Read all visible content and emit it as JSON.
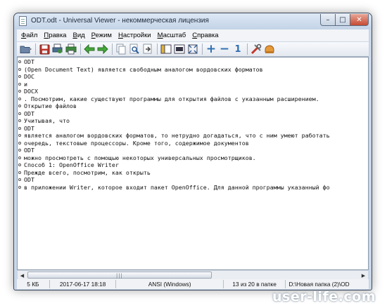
{
  "window": {
    "title": "ODT.odt - Universal Viewer - некоммерческая лицензия"
  },
  "window_controls": {
    "minimize": "–",
    "maximize": "□",
    "close": "✕"
  },
  "menu": {
    "items": [
      {
        "underlined": "Ф",
        "rest": "айл"
      },
      {
        "underlined": "П",
        "rest": "равка"
      },
      {
        "underlined": "В",
        "rest": "ид"
      },
      {
        "underlined": "Р",
        "rest": "ежим"
      },
      {
        "underlined": "Н",
        "rest": "астройки"
      },
      {
        "underlined": "М",
        "rest": "асштаб"
      },
      {
        "underlined": "С",
        "rest": "правка"
      }
    ]
  },
  "toolbar": {
    "icons": [
      "open-folder-icon",
      "save-icon",
      "print-setup-icon",
      "print-icon",
      "back-arrow-icon",
      "forward-arrow-icon",
      "copy-icon",
      "find-icon",
      "goto-icon",
      "view-mode-left-icon",
      "view-mode-fullscreen-icon",
      "fit-window-icon",
      "zoom-in-icon",
      "zoom-out-icon",
      "zoom-reset-icon",
      "tools-icon",
      "options-icon"
    ],
    "zoom_in": "+",
    "zoom_out": "−",
    "zoom_reset": "1"
  },
  "content": {
    "lines": [
      "ODT",
      "(Open Document Text) является свободным аналогом вордовских форматов",
      "DOC",
      "и",
      "DOCX",
      ". Посмотрим,  какие существуют программы для открытия файлов с указанным расширением.",
      "Открытие файлов",
      "ODT",
      "Учитывая, что",
      "ODT",
      "является аналогом вордовских форматов, то нетрудно догадаться, что с ним умеют работать",
      "очередь, текстовые процессоры. Кроме того, содержимое документов",
      "ODT",
      "можно просмотреть с помощью некоторых универсальных просмотрщиков.",
      "Способ 1: OpenOffice Writer",
      "Прежде всего, посмотрим, как открыть",
      "ODT",
      "в приложении Writer, которое входит пакет OpenOffice. Для данной программы указанный фо"
    ]
  },
  "scrollbar": {
    "left_arrow": "◀",
    "right_arrow": "▶",
    "grip": "|||"
  },
  "status": {
    "size": "5 КБ",
    "date": "2017-06-17 18:18",
    "encoding": "ANSI (Windows)",
    "position": "13 из 20 в папке",
    "path": "D:\\Новая папка (2)\\OD"
  },
  "watermark": "user-life.com"
}
